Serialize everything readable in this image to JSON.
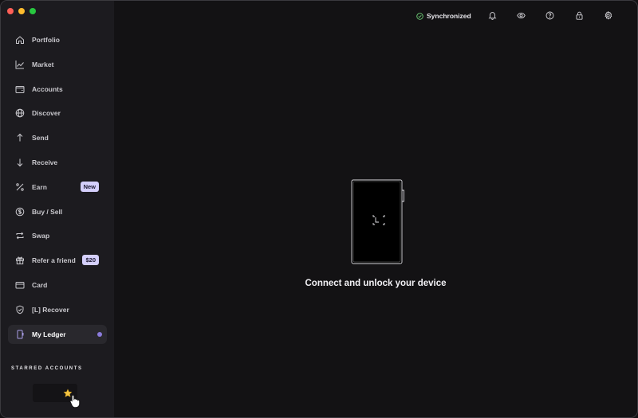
{
  "sidebar": {
    "items": [
      {
        "label": "Portfolio",
        "icon": "home-icon"
      },
      {
        "label": "Market",
        "icon": "chart-line-icon"
      },
      {
        "label": "Accounts",
        "icon": "wallet-icon"
      },
      {
        "label": "Discover",
        "icon": "globe-icon"
      },
      {
        "label": "Send",
        "icon": "arrow-up-icon"
      },
      {
        "label": "Receive",
        "icon": "arrow-down-icon"
      },
      {
        "label": "Earn",
        "icon": "percent-icon",
        "badge": "New"
      },
      {
        "label": "Buy / Sell",
        "icon": "dollar-icon"
      },
      {
        "label": "Swap",
        "icon": "swap-icon"
      },
      {
        "label": "Refer a friend",
        "icon": "gift-icon",
        "badge": "$20"
      },
      {
        "label": "Card",
        "icon": "card-icon"
      },
      {
        "label": "[L] Recover",
        "icon": "shield-icon"
      },
      {
        "label": "My Ledger",
        "icon": "device-icon",
        "active": true
      }
    ],
    "starred_title": "STARRED ACCOUNTS"
  },
  "topbar": {
    "sync_label": "Synchronized",
    "icons": [
      "bell-icon",
      "eye-icon",
      "help-icon",
      "lock-icon",
      "gear-icon"
    ]
  },
  "main": {
    "message": "Connect and unlock your device"
  },
  "colors": {
    "background": "#131214",
    "sidebar": "#1c1b1f",
    "badge": "#d4cffb",
    "accent": "#8b7bdc",
    "sync_ok": "#6fcf78",
    "star": "#f5c542"
  }
}
